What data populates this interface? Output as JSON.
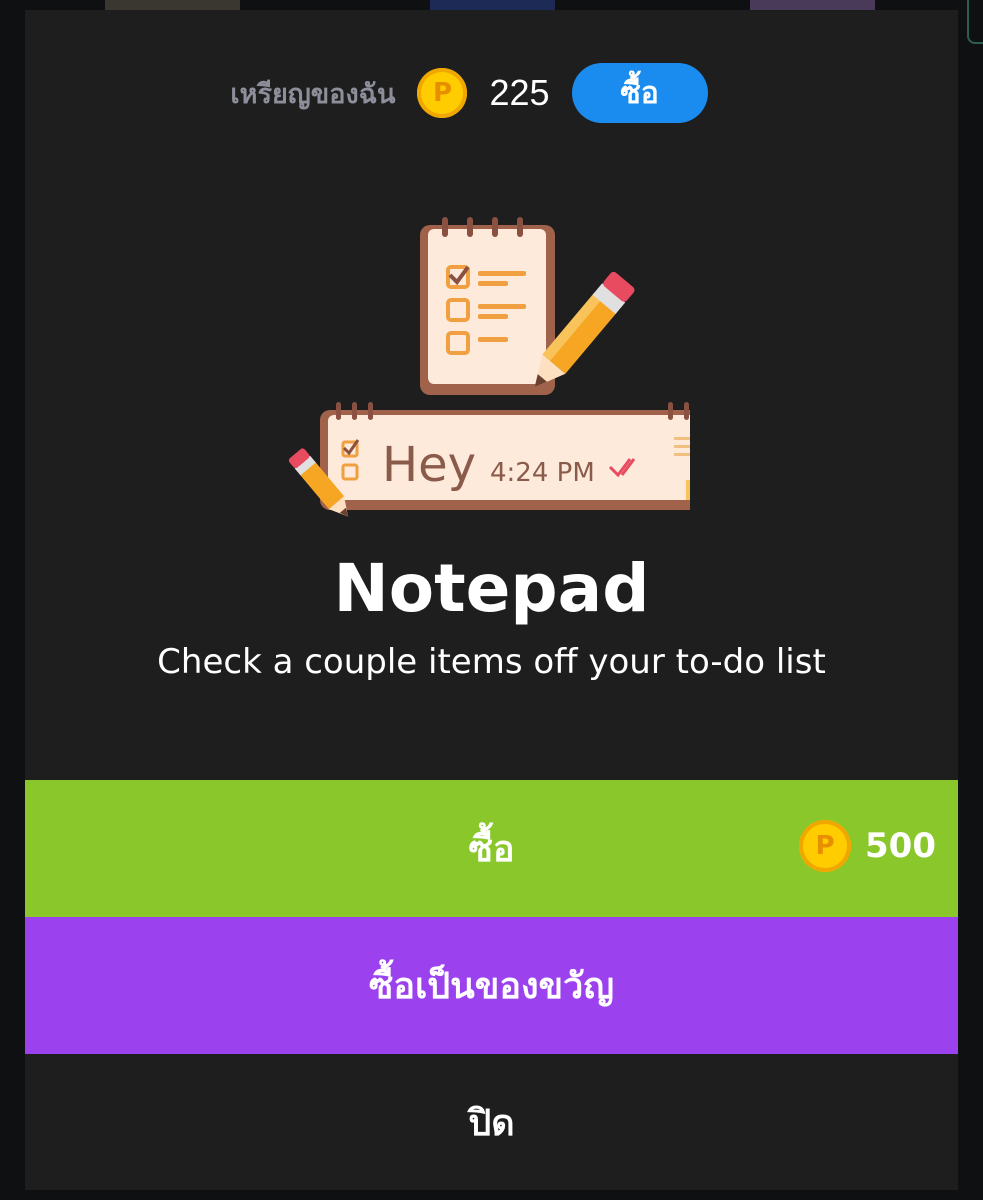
{
  "wallet": {
    "label": "เหรียญของฉัน",
    "coin_symbol": "P",
    "balance": "225",
    "buy_label": "ซื้อ"
  },
  "item": {
    "title": "Notepad",
    "description": "Check a couple items off your to-do list",
    "illustration_text": "Hey",
    "illustration_time": "4:24 PM",
    "illustration_icon": "notepad-with-pencil"
  },
  "actions": {
    "buy_label": "ซื้อ",
    "price": "500",
    "gift_label": "ซื้อเป็นของขวัญ",
    "close_label": "ปิด"
  },
  "colors": {
    "buy_small": "#1a8cf0",
    "buy_main": "#89c72a",
    "gift": "#9b42ee",
    "background": "#1e1e1e",
    "coin": "#ffcc00"
  }
}
